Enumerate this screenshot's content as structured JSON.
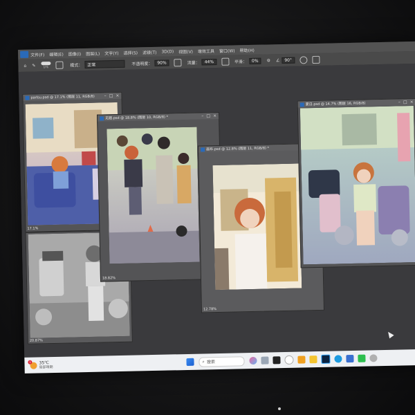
{
  "menu": {
    "items": [
      "文件(F)",
      "编辑(E)",
      "图像(I)",
      "图层(L)",
      "文字(Y)",
      "选择(S)",
      "滤镜(T)",
      "3D(D)",
      "视图(V)",
      "增效工具",
      "窗口(W)",
      "帮助(H)"
    ]
  },
  "options": {
    "brush_size": "171",
    "mode_label": "模式：",
    "mode_value": "正常",
    "opacity_label": "不透明度：",
    "opacity_value": "90%",
    "flow_label": "流量：",
    "flow_value": "44%",
    "smooth_label": "平滑：",
    "smooth_value": "0%",
    "angle_value": "90°"
  },
  "documents": [
    {
      "title": "parlsu.psd @ 17.1% (图层 11, RGB/8)",
      "zoom": "17.1%"
    },
    {
      "title": "",
      "zoom": "20.87%"
    },
    {
      "title": "无题.psd @ 18.8% (图层 10, RGB/8) *",
      "zoom": "18.82%"
    },
    {
      "title": "画布.psd @ 12.8% (图层 11, RGB/8) *",
      "zoom": "12.78%"
    },
    {
      "title": "夏日.psd @ 14.7% (图层 16, RGB/8)",
      "zoom": ""
    }
  ],
  "taskbar": {
    "weather_temp": "35℃",
    "weather_desc": "局部晴朗",
    "search_placeholder": "搜索",
    "weather_badge": "1"
  },
  "colors": {
    "accent_blue": "#2a6ab8",
    "workspace": "#3a3a3d",
    "taskbar": "#eef0f3"
  }
}
